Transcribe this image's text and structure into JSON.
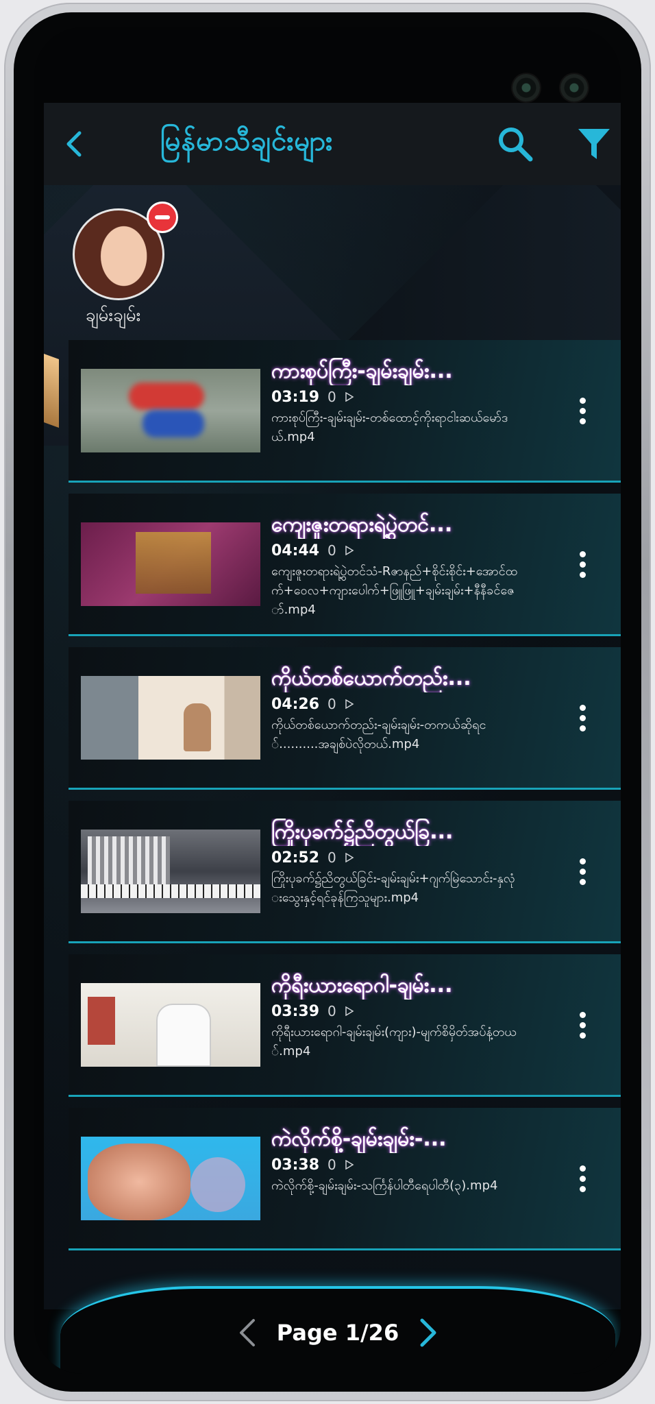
{
  "header": {
    "title": "မြန်မာသီချင်းများ"
  },
  "artist": {
    "name": "ချမ်းချမ်း"
  },
  "videos": [
    {
      "title": "ကားစုပ်ကြီး-ချမ်းချမ်း...",
      "duration": "03:19",
      "views": "0",
      "filename": "ကားစုပ်ကြီး-ချမ်းချမ်း-တစ်ထောင့်ကိုးရာငါးဆယ်မော်ဒယ်.mp4"
    },
    {
      "title": "ကျေးဇူးတရားရဲ့ပွဲတင်...",
      "duration": "04:44",
      "views": "0",
      "filename": "ကျေးဇူးတရားရဲ့ပွဲတင်သံ-Rဇာနည်+စိုင်းစိုင်း+အောင်ထက်+ဝေလ+ကျားပေါက်+ဖြူဖြူ+ချမ်းချမ်း+နီနီခင်ဇော်.mp4"
    },
    {
      "title": "ကိုယ်တစ်ယောက်တည်း...",
      "duration": "04:26",
      "views": "0",
      "filename": "ကိုယ်တစ်ယောက်တည်း-ချမ်းချမ်း-တကယ်ဆိုရင်..........အချစ်ပဲလိုတယ်.mp4"
    },
    {
      "title": "ကြိုးပုခက်၌ညိတွယ်ခြ...",
      "duration": "02:52",
      "views": "0",
      "filename": "ကြိုးပုခက်၌ညိတွယ်ခြင်း-ချမ်းချမ်း+ဂျက်မြဲသောင်း-နှလုံးသွေးနှင့်ရင်ခုန်ကြသူများ.mp4"
    },
    {
      "title": "ကိုရီးယားရောဂါ-ချမ်း...",
      "duration": "03:39",
      "views": "0",
      "filename": "ကိုရီးယားရောဂါ-ချမ်းချမ်း(ကျား)-မျက်စိမှိတ်အပ်နံ့တယ်.mp4"
    },
    {
      "title": "ကဲလိုက်စို့-ချမ်းချမ်း-...",
      "duration": "03:38",
      "views": "0",
      "filename": "ကဲလိုက်စို့-ချမ်းချမ်း-သင်္ကြန်ပါတီရေပါတီ(၃).mp4"
    }
  ],
  "pagination": {
    "label": "Page 1/26"
  },
  "colors": {
    "accent": "#27b7d9",
    "remove_badge": "#e8343a",
    "title_glow": "#c061e0"
  },
  "icons": {
    "back": "chevron-left-icon",
    "search": "search-icon",
    "filter": "filter-icon",
    "more": "more-vertical-icon",
    "play": "play-outline-icon",
    "prev": "chevron-left-icon",
    "next": "chevron-right-icon"
  }
}
